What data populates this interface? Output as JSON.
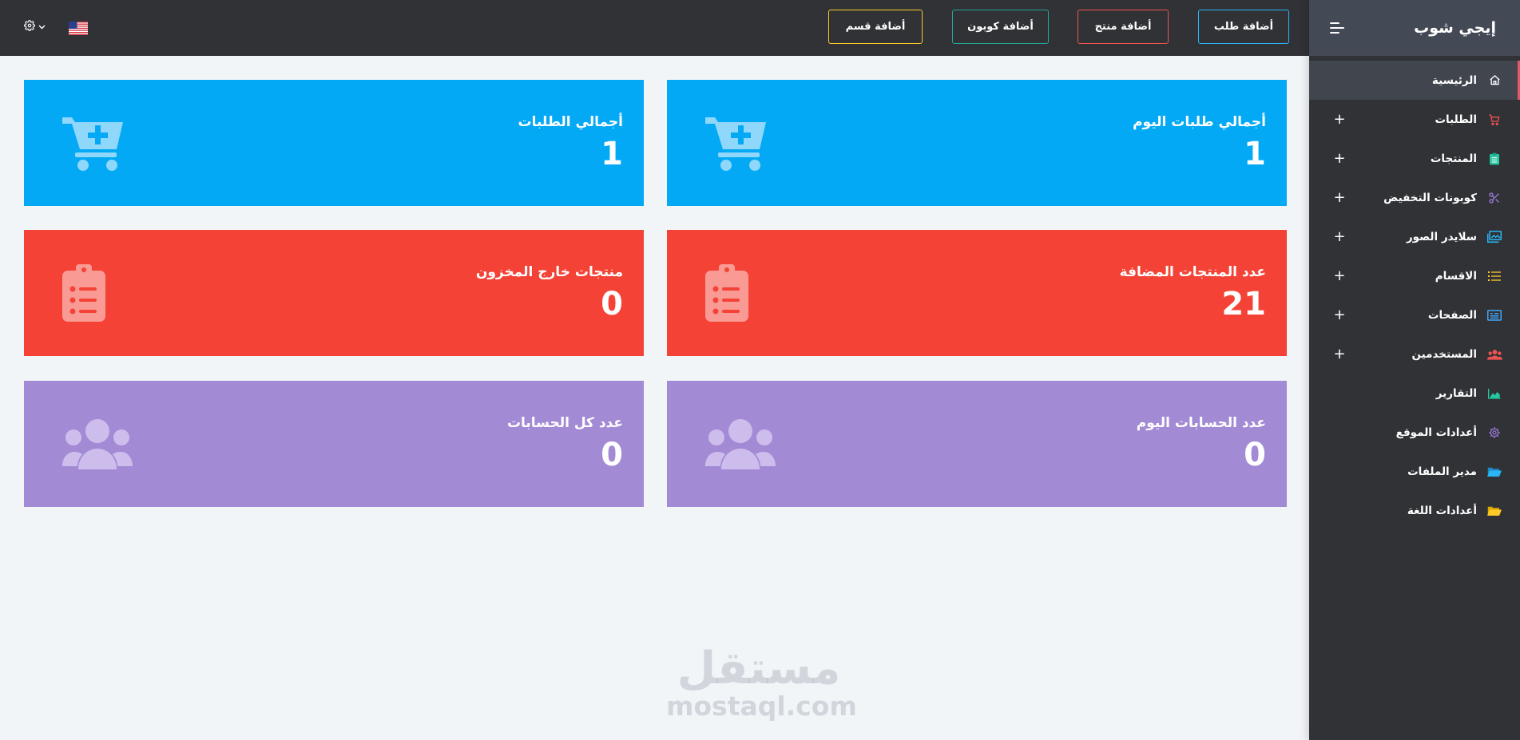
{
  "app": {
    "brand": "إيجي شوب"
  },
  "topbar": {
    "buttons": {
      "add_order": "أضافة طلب",
      "add_product": "أضافة منتج",
      "add_coupon": "أضافة كوبون",
      "add_section": "أضافة قسم"
    },
    "language_icon": "us-flag-icon",
    "settings_icon": "gear-icon"
  },
  "sidebar": {
    "items": [
      {
        "label": "الرئيسية",
        "icon": "home-icon",
        "color": "#ffffff",
        "active": true,
        "expandable": false
      },
      {
        "label": "الطلبات",
        "icon": "cart-icon",
        "color": "#ef5350",
        "expandable": true
      },
      {
        "label": "المنتجات",
        "icon": "clipboard-icon",
        "color": "#26c6a0",
        "expandable": true
      },
      {
        "label": "كوبونات التخفيض",
        "icon": "scissors-icon",
        "color": "#9575cd",
        "expandable": true
      },
      {
        "label": "سلايدر الصور",
        "icon": "images-icon",
        "color": "#29b6f6",
        "expandable": true
      },
      {
        "label": "الاقسام",
        "icon": "list-icon",
        "color": "#ffca28",
        "expandable": true
      },
      {
        "label": "الصفحات",
        "icon": "newspaper-icon",
        "color": "#42a5f5",
        "expandable": true
      },
      {
        "label": "المستخدمين",
        "icon": "users-icon",
        "color": "#ef5350",
        "expandable": true
      },
      {
        "label": "التقارير",
        "icon": "area-chart-icon",
        "color": "#26c6a0",
        "expandable": false
      },
      {
        "label": "أعدادات الموقع",
        "icon": "gear-icon",
        "color": "#9575cd",
        "expandable": false
      },
      {
        "label": "مدير الملفات",
        "icon": "folder-open-icon",
        "color": "#29b6f6",
        "expandable": false
      },
      {
        "label": "أعدادات اللغة",
        "icon": "folder-open-icon",
        "color": "#ffca28",
        "expandable": false
      }
    ]
  },
  "stats": {
    "today_orders": {
      "title": "أجمالي طلبات اليوم",
      "value": "1",
      "icon": "cart-plus-icon"
    },
    "total_orders": {
      "title": "أجمالي الطلبات",
      "value": "1",
      "icon": "cart-plus-icon"
    },
    "products_added": {
      "title": "عدد المنتجات المضافة",
      "value": "21",
      "icon": "clipboard-list-icon"
    },
    "out_of_stock": {
      "title": "منتجات خارج المخزون",
      "value": "0",
      "icon": "clipboard-list-icon"
    },
    "today_accounts": {
      "title": "عدد الحسابات اليوم",
      "value": "0",
      "icon": "users-icon"
    },
    "all_accounts": {
      "title": "عدد كل الحسابات",
      "value": "0",
      "icon": "users-icon"
    }
  },
  "colors": {
    "blue": "#03a9f4",
    "red": "#f44336",
    "purple": "#a38ad4",
    "sidebar": "#303236"
  },
  "watermark": {
    "arabic": "مستقل",
    "latin": "mostaql.com"
  }
}
